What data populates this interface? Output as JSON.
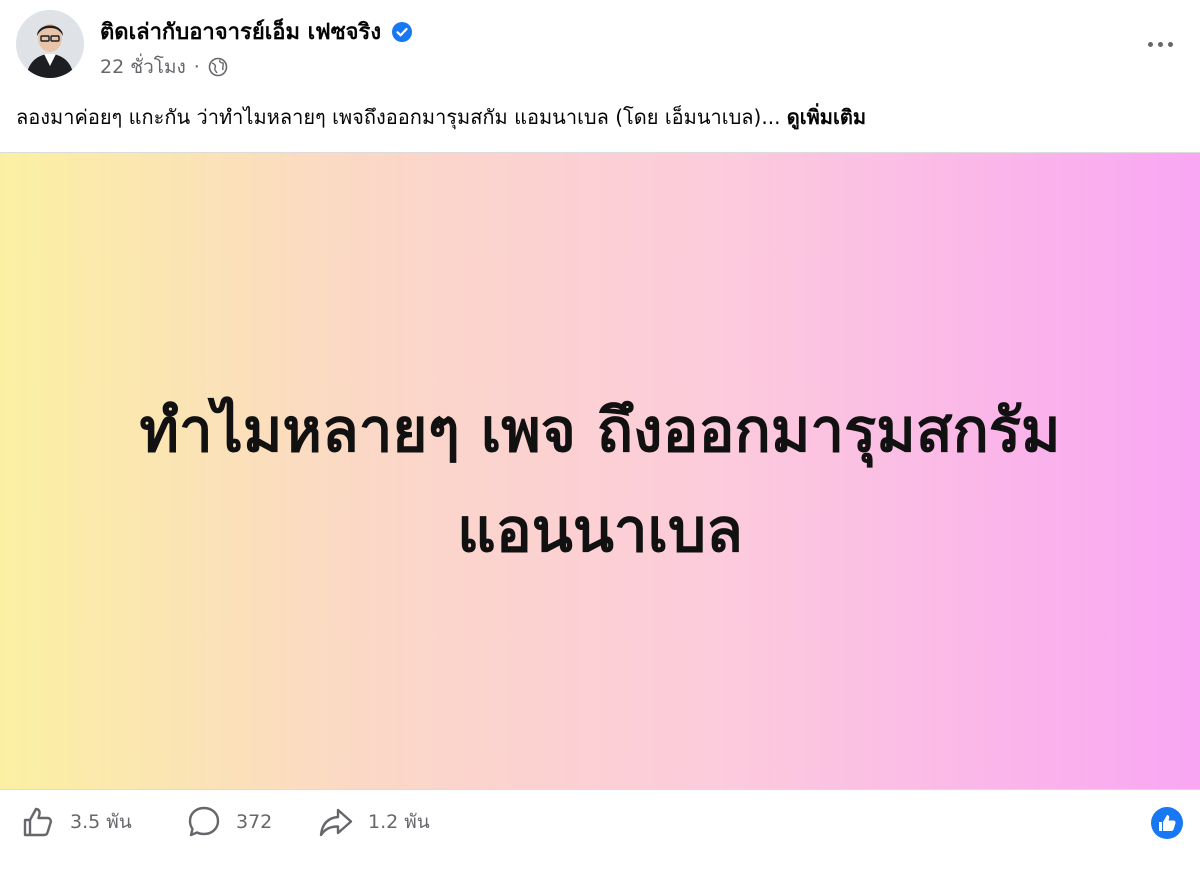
{
  "post": {
    "author": "ติดเล่ากับอาจารย์เอ็ม เฟซจริง",
    "time": "22 ชั่วโมง",
    "separator": "·",
    "caption": "ลองมาค่อยๆ แกะกัน ว่าทำไมหลายๆ เพจถึงออกมารุมสกัม แอมนาเบล (โดย เอ็มนาเบล)...",
    "see_more": "ดูเพิ่มเติม",
    "card_line1": "ทำไมหลายๆ เพจ ถึงออกมารุมสกรัม",
    "card_line2": "แอนนาเบล",
    "card_gradient": [
      "#fbf0a2",
      "#fbd8c6",
      "#fccbdc",
      "#f9a6f3"
    ]
  },
  "actions": {
    "likes": "3.5 พัน",
    "comments": "372",
    "shares": "1.2 พัน"
  },
  "colors": {
    "verified": "#1877f2",
    "muted": "#65676b",
    "like_badge": "#1877f2"
  },
  "icons": [
    "verified-badge-icon",
    "globe-icon",
    "more-options-icon",
    "like-icon",
    "comment-icon",
    "share-icon",
    "like-reaction-icon"
  ]
}
